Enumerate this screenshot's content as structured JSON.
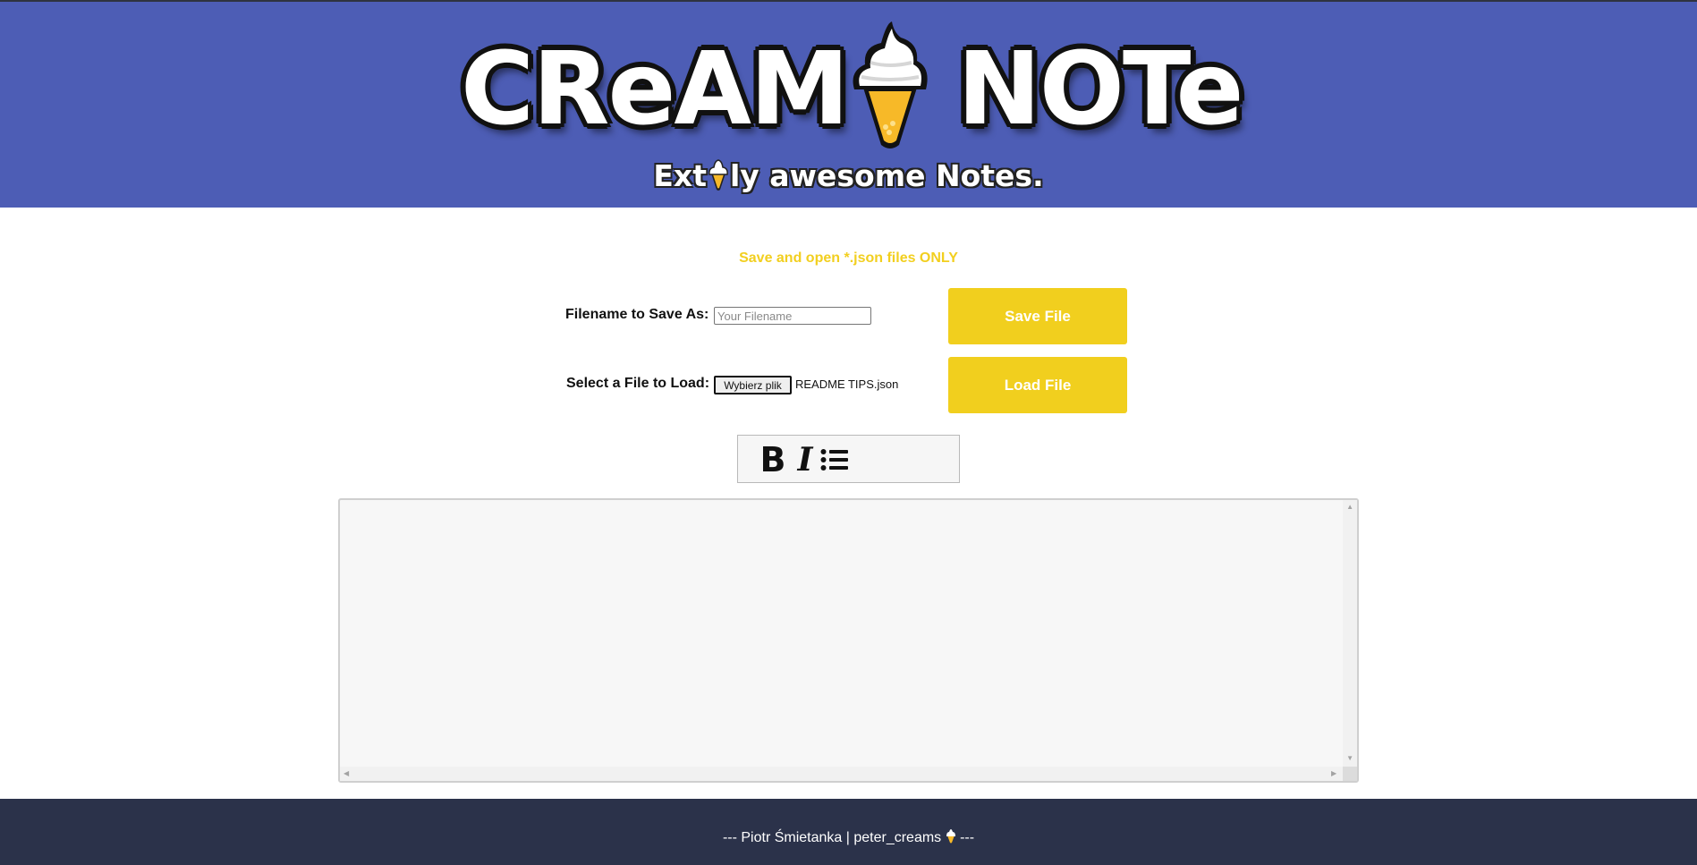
{
  "header": {
    "logo_left": "CReAM",
    "logo_right": "NOTe",
    "tagline_before": "Ext",
    "tagline_after": "ly awesome Notes."
  },
  "notice": "Save and open *.json files ONLY",
  "save_row": {
    "label": "Filename to Save As:",
    "input_value": "",
    "input_placeholder": "Your Filename",
    "button_label": "Save File"
  },
  "load_row": {
    "label": "Select a File to Load:",
    "choose_button_label": "Wybierz plik",
    "selected_file": "README TIPS.json",
    "button_label": "Load File"
  },
  "toolbar": {
    "bold_label": "B",
    "italic_label": "I",
    "list_icon": "list-icon"
  },
  "editor": {
    "content": ""
  },
  "footer": {
    "text_before": "--- Piotr Śmietanka | peter_creams",
    "text_after": "---"
  },
  "colors": {
    "header_bg": "#4d5db5",
    "accent_yellow": "#f1cf1e",
    "footer_bg": "#2b324a",
    "editor_bg": "#f7f7f7"
  }
}
